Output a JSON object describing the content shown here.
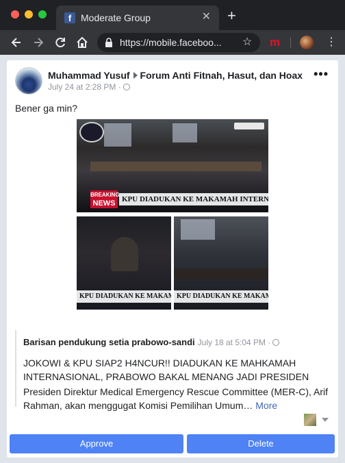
{
  "browser": {
    "tab_title": "Moderate Group",
    "tab_close": "✕",
    "new_tab": "+",
    "url": "https://mobile.faceboo...",
    "extension_label": "m",
    "menu": "⋮",
    "star": "☆"
  },
  "post": {
    "author": "Muhammad Yusuf",
    "group": "Forum Anti Fitnah, Hasut, dan Hoax",
    "time": "July 24 at 2:28 PM ·",
    "more_menu": "•••",
    "text": "Bener ga min?",
    "photos": {
      "main_caption": "KPU DIADUKAN KE MAKAMAH INTERNASIONAL",
      "small_caption": "KPU DIADUKAN KE MAKAMAH INTER",
      "breaking_label": "BREAKING",
      "news_label": "NEWS"
    }
  },
  "shared": {
    "author": "Barisan pendukung setia prabowo-sandi",
    "time": "July 18 at 5:04 PM ·",
    "title": "JOKOWI & KPU SIAP2 H4NCUR!! DIADUKAN KE MAHKAMAH INTERNASIONAL, PRABOWO BAKAL MENANG JADI PRESIDEN",
    "body": "Presiden Direktur Medical Emergency Rescue Committee (MER-C), Arif Rahman, akan menggugat Komisi Pemilihan Umum…",
    "more_link": "More"
  },
  "actions": {
    "approve": "Approve",
    "delete": "Delete"
  },
  "icons": [
    "facebook-icon",
    "close-icon",
    "back-icon",
    "forward-icon",
    "reload-icon",
    "home-icon",
    "lock-icon",
    "star-icon",
    "globe-icon",
    "chevron-down-icon"
  ],
  "colors": {
    "chrome_dark": "#202124",
    "button_blue": "#4e82f5",
    "link_blue": "#4267b2",
    "breaking_red": "#c8102e"
  }
}
